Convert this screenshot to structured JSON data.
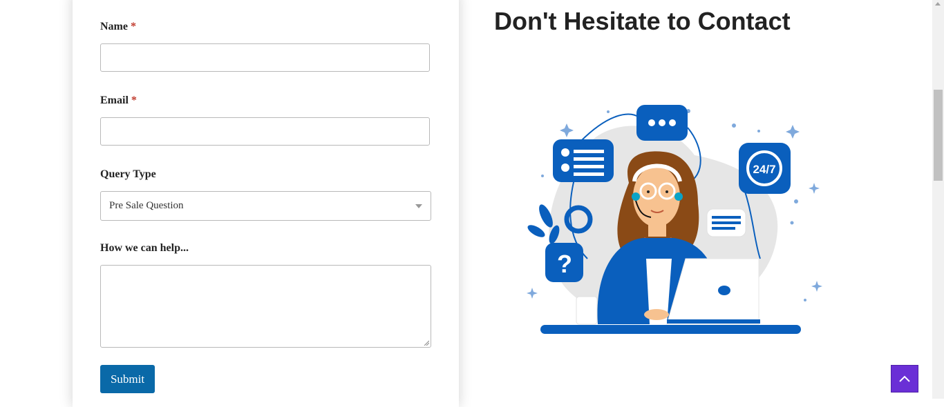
{
  "form": {
    "name_label": "Name",
    "email_label": "Email",
    "required_mark": "*",
    "query_type_label": "Query Type",
    "query_type_selected": "Pre Sale Question",
    "help_label": "How we can help...",
    "submit_label": "Submit"
  },
  "contact": {
    "heading": "Don't Hesitate to Contact",
    "badge_text": "24/7"
  },
  "colors": {
    "submit_button": "#0a69a8",
    "back_to_top_button": "#6a2fd6",
    "illustration_blue": "#0a5fbd",
    "required_mark": "#c0392b"
  },
  "icons": {
    "back_to_top": "chevron-up-icon",
    "select_caret": "caret-down-icon"
  }
}
